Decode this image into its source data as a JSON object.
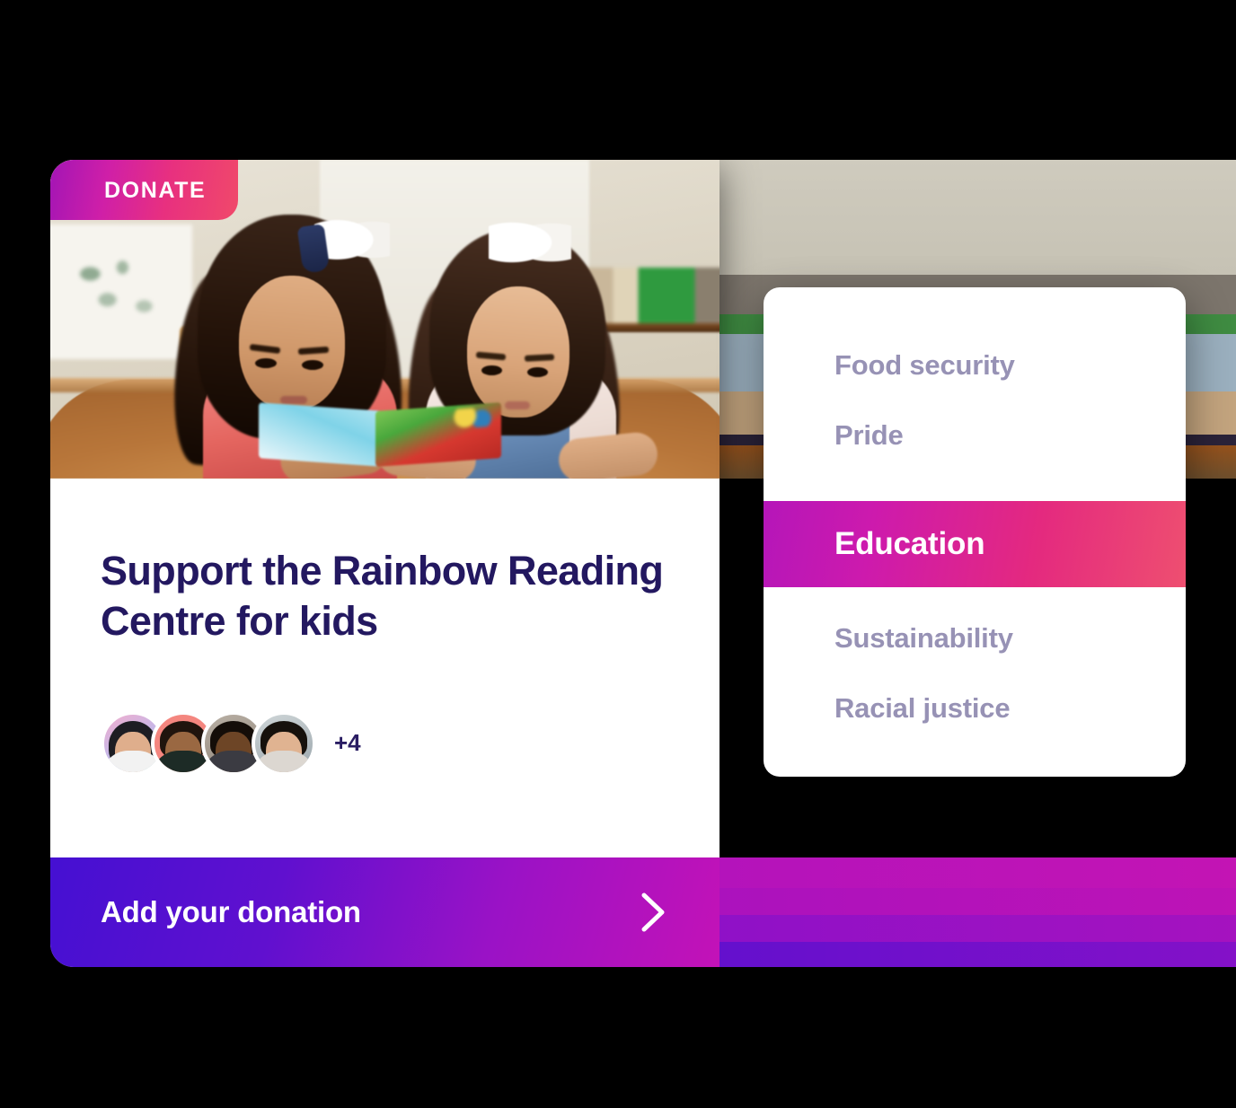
{
  "card": {
    "badge_label": "DONATE",
    "title": "Support the Rainbow Reading Centre for kids",
    "supporters": {
      "avatars": [
        {
          "name": "supporter-avatar-1"
        },
        {
          "name": "supporter-avatar-2"
        },
        {
          "name": "supporter-avatar-3"
        },
        {
          "name": "supporter-avatar-4"
        }
      ],
      "more_count_label": "+4"
    },
    "cta": {
      "label": "Add your donation",
      "icon": "chevron-right-icon"
    },
    "photo_alt": "Two young girls reading a picture book together at a classroom table"
  },
  "category_dropdown": {
    "items": [
      {
        "label": "Food security",
        "selected": false
      },
      {
        "label": "Pride",
        "selected": false
      },
      {
        "label": "Education",
        "selected": true
      },
      {
        "label": "Sustainability",
        "selected": false
      },
      {
        "label": "Racial justice",
        "selected": false
      }
    ]
  },
  "colors": {
    "title_navy": "#231860",
    "badge_gradient_start": "#a315b5",
    "badge_gradient_end": "#f0496a",
    "cta_gradient_start": "#4510d2",
    "cta_gradient_end": "#c312b7",
    "dropdown_item_text": "#9792b5",
    "dropdown_active_start": "#b516b9",
    "dropdown_active_end": "#ee4f70",
    "page_background": "#000000"
  }
}
